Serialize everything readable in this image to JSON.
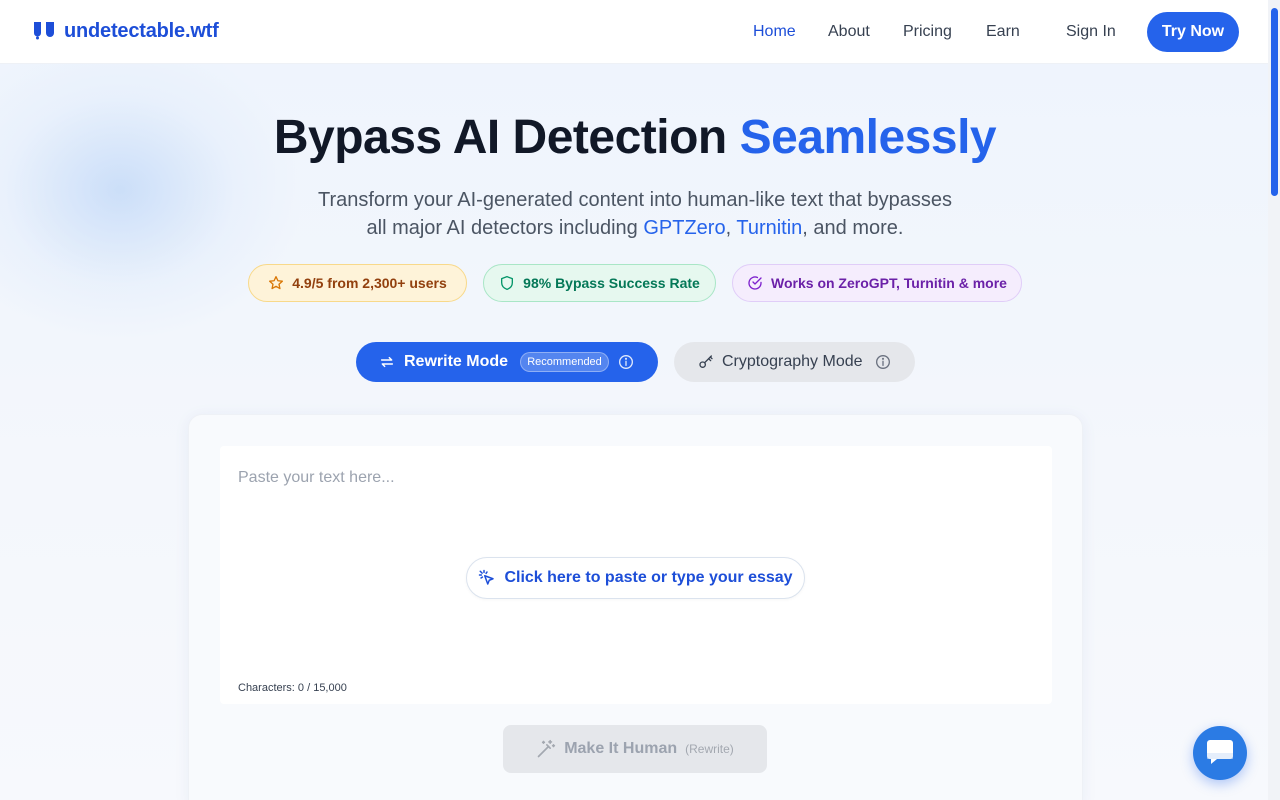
{
  "brand": {
    "name": "undetectable.wtf",
    "color": "#1d4ed8"
  },
  "nav": {
    "items": [
      {
        "label": "Home",
        "active": true
      },
      {
        "label": "About",
        "active": false
      },
      {
        "label": "Pricing",
        "active": false
      },
      {
        "label": "Earn",
        "active": false
      }
    ],
    "sign_in": "Sign In",
    "cta": "Try Now"
  },
  "hero": {
    "title_main": "Bypass AI Detection ",
    "title_accent": "Seamlessly",
    "subtitle_line1": "Transform your AI-generated content into human-like text that bypasses",
    "subtitle_line2_prefix": "all major AI detectors including ",
    "subtitle_link1": "GPTZero",
    "subtitle_sep": ", ",
    "subtitle_link2": "Turnitin",
    "subtitle_suffix": ", and more."
  },
  "badges": {
    "rating": {
      "label": "4.9/5 from 2,300+ users",
      "icon": "star-icon"
    },
    "success": {
      "label": "98% Bypass Success Rate",
      "icon": "shield-icon"
    },
    "works": {
      "label": "Works on ZeroGPT, Turnitin & more",
      "icon": "check-circle-icon"
    }
  },
  "modes": {
    "rewrite": {
      "label": "Rewrite Mode",
      "badge": "Recommended",
      "icon": "swap-arrows-icon",
      "selected": true
    },
    "crypto": {
      "label": "Cryptography Mode",
      "icon": "key-icon",
      "selected": false
    }
  },
  "editor": {
    "placeholder": "Paste your text here...",
    "value": "",
    "paste_prompt": "Click here to paste or type your essay",
    "char_count": "Characters: 0 / 15,000"
  },
  "action": {
    "label": "Make It Human",
    "sub_label": "(Rewrite)",
    "enabled": false
  },
  "colors": {
    "accent": "#2563eb",
    "rating_bg": "#fef3d9",
    "success_bg": "#e6f8ef",
    "works_bg": "#f5edfd"
  }
}
